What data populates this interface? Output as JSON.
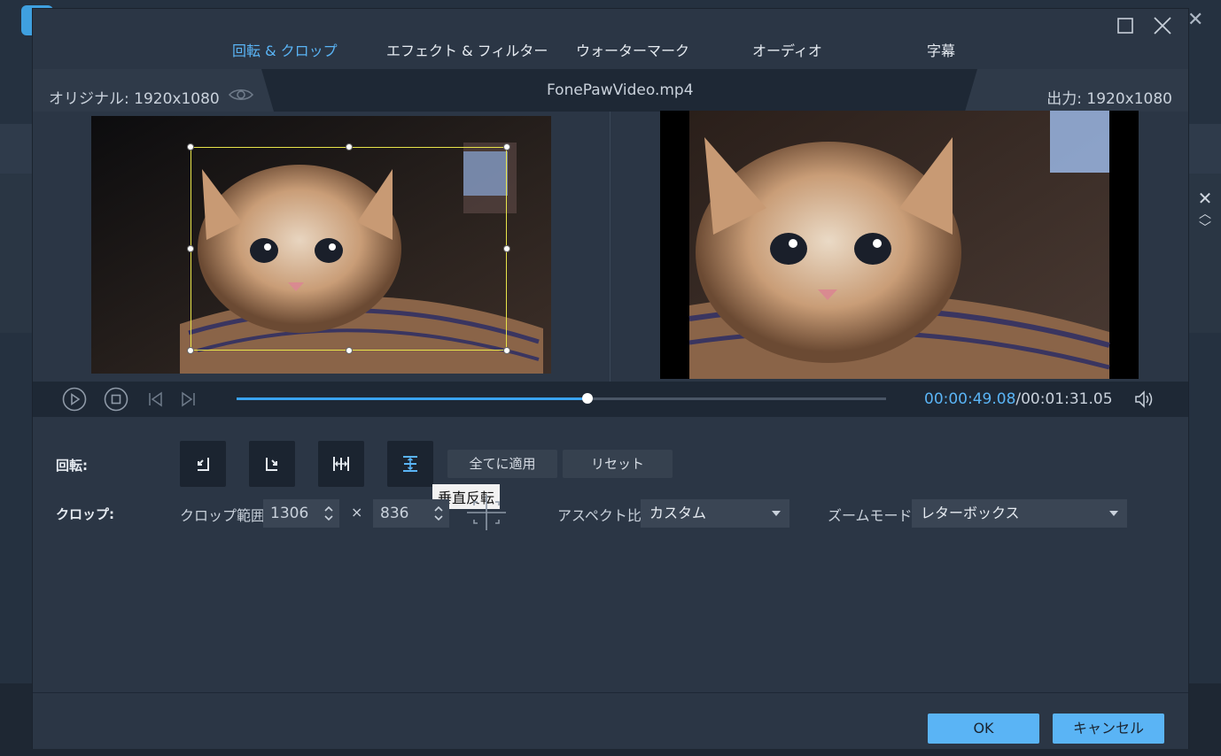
{
  "tabs": [
    {
      "label": "回転 & クロップ",
      "active": true
    },
    {
      "label": "エフェクト & フィルター",
      "active": false
    },
    {
      "label": "ウォーターマーク",
      "active": false
    },
    {
      "label": "オーディオ",
      "active": false
    },
    {
      "label": "字幕",
      "active": false
    }
  ],
  "window_controls": {
    "maximize": "☐",
    "close": "✕"
  },
  "info": {
    "original": "オリジナル: 1920x1080",
    "filename": "FonePawVideo.mp4",
    "output": "出力: 1920x1080"
  },
  "player": {
    "time_current": "00:00:49.08",
    "time_total": "/00:01:31.05",
    "progress": 0.54,
    "icons": [
      "play-icon",
      "stop-icon",
      "prev-frame-icon",
      "next-frame-icon",
      "volume-icon"
    ]
  },
  "rotate": {
    "label": "回転:",
    "buttons": [
      "rotate-left-icon",
      "rotate-right-icon",
      "flip-horizontal-icon",
      "flip-vertical-icon"
    ],
    "apply_all": "全てに適用",
    "reset": "リセット",
    "tooltip": "垂直反転"
  },
  "crop": {
    "label": "クロップ:",
    "area_label": "クロップ範囲:",
    "width": "1306",
    "times": "×",
    "height": "836",
    "aspect_label": "アスペクト比:",
    "aspect_value": "カスタム",
    "zoom_label": "ズームモード:",
    "zoom_value": "レターボックス"
  },
  "footer": {
    "ok": "OK",
    "cancel": "キャンセル"
  },
  "colors": {
    "accent": "#5ab4f5",
    "dialog_bg": "#2b3645",
    "bar_bg": "#1e2835"
  }
}
